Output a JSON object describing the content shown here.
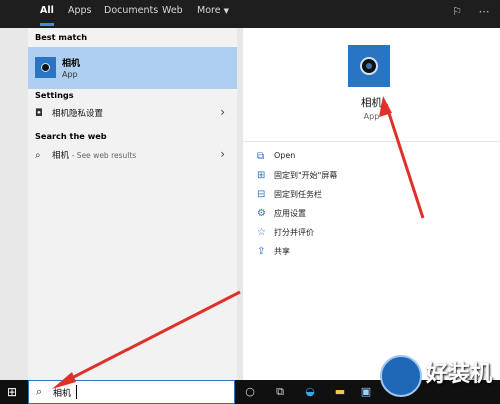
{
  "tabs": {
    "all": "All",
    "apps": "Apps",
    "documents": "Documents",
    "web": "Web",
    "more": "More"
  },
  "left": {
    "best_match_title": "Best match",
    "best": {
      "title": "相机",
      "sub": "App"
    },
    "settings_title": "Settings",
    "settings_item": "相机隐私设置",
    "web_title": "Search the web",
    "web_query": "相机",
    "web_suffix": "- See web results"
  },
  "right": {
    "app_title": "相机",
    "app_sub": "App",
    "actions": [
      {
        "label": "Open",
        "icon": "open-icon"
      },
      {
        "label": "固定到\"开始\"屏幕",
        "icon": "pin-start-icon"
      },
      {
        "label": "固定到任务栏",
        "icon": "pin-taskbar-icon"
      },
      {
        "label": "应用设置",
        "icon": "gear-icon"
      },
      {
        "label": "打分并评价",
        "icon": "star-icon"
      },
      {
        "label": "共享",
        "icon": "share-icon"
      }
    ]
  },
  "taskbar": {
    "search_value": "相机"
  },
  "watermark": {
    "text": "好装机"
  },
  "colors": {
    "accent": "#2a74c4",
    "selection": "#afcff0",
    "arrow": "#e0302a"
  }
}
